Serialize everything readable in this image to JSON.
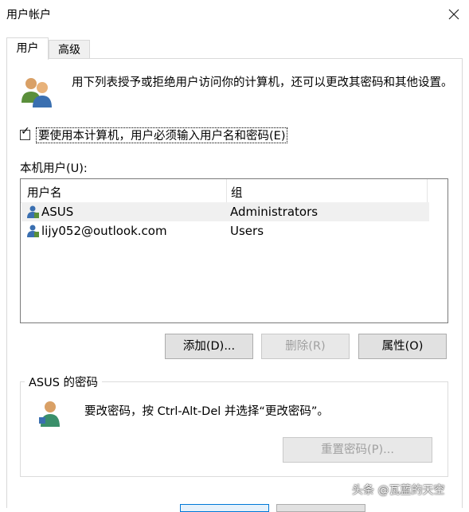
{
  "window": {
    "title": "用户帐户",
    "close_glyph": "✕"
  },
  "tabs": [
    {
      "label": "用户",
      "selected": true
    },
    {
      "label": "高级",
      "selected": false
    }
  ],
  "intro_text": "用下列表授予或拒绝用户访问你的计算机，还可以更改其密码和其他设置。",
  "require_login": {
    "checked": true,
    "check_glyph": "✓",
    "label": "要使用本计算机，用户必须输入用户名和密码(E)"
  },
  "local_users_label": "本机用户(U):",
  "list": {
    "columns": [
      "用户名",
      "组"
    ],
    "rows": [
      {
        "name": "ASUS",
        "group": "Administrators",
        "selected": true
      },
      {
        "name": "lijy052@outlook.com",
        "group": "Users",
        "selected": false
      }
    ]
  },
  "buttons": {
    "add": "添加(D)...",
    "delete": "删除(R)",
    "properties": "属性(O)"
  },
  "password_group": {
    "title": "ASUS 的密码",
    "text": "要改密码，按 Ctrl-Alt-Del 并选择“更改密码”。",
    "reset_button": "重置密码(P)..."
  },
  "watermark": "头条 @瓦蓝的天空",
  "colors": {
    "accent": "#0078d7",
    "selected_row": "#f0f0f0",
    "disabled_text": "#a0a0a0"
  },
  "icons": {
    "users_icon": "users-group-icon",
    "user_row_icon": "user-account-icon",
    "password_icon": "user-key-icon"
  }
}
